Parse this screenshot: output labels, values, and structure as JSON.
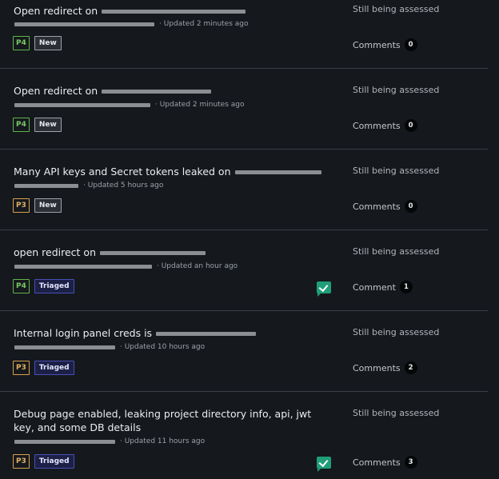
{
  "reports": [
    {
      "title": "Open redirect on",
      "updated": "· Updated 2 minutes ago",
      "severity": "P4",
      "state": "New",
      "status": "Still being assessed",
      "comments_label": "Comments",
      "comments_count": "0"
    },
    {
      "title": "Open redirect on",
      "updated": "· Updated 2 minutes ago",
      "severity": "P4",
      "state": "New",
      "status": "Still being assessed",
      "comments_label": "Comments",
      "comments_count": "0"
    },
    {
      "title": "Many API keys and Secret tokens leaked on",
      "updated": "· Updated 5 hours ago",
      "severity": "P3",
      "state": "New",
      "status": "Still being assessed",
      "comments_label": "Comments",
      "comments_count": "0"
    },
    {
      "title": "open redirect on",
      "updated": "· Updated an hour ago",
      "severity": "P4",
      "state": "Triaged",
      "status": "Still being assessed",
      "comments_label": "Comment",
      "comments_count": "1",
      "icon": "check-comment-icon"
    },
    {
      "title": "Internal login panel creds is",
      "updated": "· Updated 10 hours ago",
      "severity": "P3",
      "state": "Triaged",
      "status": "Still being assessed",
      "comments_label": "Comments",
      "comments_count": "2"
    },
    {
      "title": "Debug page enabled, leaking project directory info, api, jwt key, and some DB details",
      "updated": "· Updated 11 hours ago",
      "severity": "P3",
      "state": "Triaged",
      "status": "Still being assessed",
      "comments_label": "Comments",
      "comments_count": "3",
      "icon": "check-comment-icon"
    }
  ],
  "colors": {
    "background": "#15181d",
    "p4": "#5fb548",
    "p3": "#d8a24b",
    "triaged": "#4650b4",
    "check": "#1f9e78"
  }
}
